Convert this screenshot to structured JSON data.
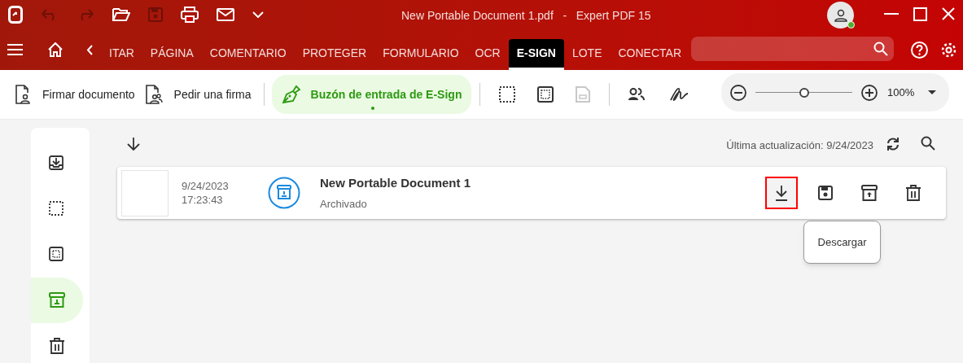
{
  "window": {
    "title": "New Portable Document 1.pdf   -   Expert PDF 15"
  },
  "ribbon_tabs": [
    {
      "label": "ITAR",
      "selected": false
    },
    {
      "label": "PÁGINA",
      "selected": false
    },
    {
      "label": "COMENTARIO",
      "selected": false
    },
    {
      "label": "PROTEGER",
      "selected": false
    },
    {
      "label": "FORMULARIO",
      "selected": false
    },
    {
      "label": "OCR",
      "selected": false
    },
    {
      "label": "E-SIGN",
      "selected": true
    },
    {
      "label": "LOTE",
      "selected": false
    },
    {
      "label": "CONECTAR",
      "selected": false
    }
  ],
  "toolbar": {
    "buttons": [
      {
        "label": "Firmar documento",
        "selected": false
      },
      {
        "label": "Pedir una firma",
        "selected": false
      },
      {
        "label": "Buzón de entrada de E-Sign",
        "selected": true
      }
    ],
    "zoom": {
      "level": 0.5,
      "value": "100%"
    }
  },
  "sidebar": {
    "items": [
      {
        "selected": false
      },
      {
        "selected": false
      },
      {
        "selected": false
      },
      {
        "selected": true
      },
      {
        "selected": false
      }
    ]
  },
  "list": {
    "last_update": "Última actualización: 9/24/2023",
    "documents": [
      {
        "date": "9/24/2023",
        "time": "17:23:43",
        "name": "New Portable Document 1",
        "status": "Archivado",
        "actions": [
          {
            "highlighted": true
          },
          {
            "highlighted": false
          },
          {
            "highlighted": false
          },
          {
            "highlighted": false
          }
        ]
      }
    ]
  },
  "tooltip": "Descargar"
}
